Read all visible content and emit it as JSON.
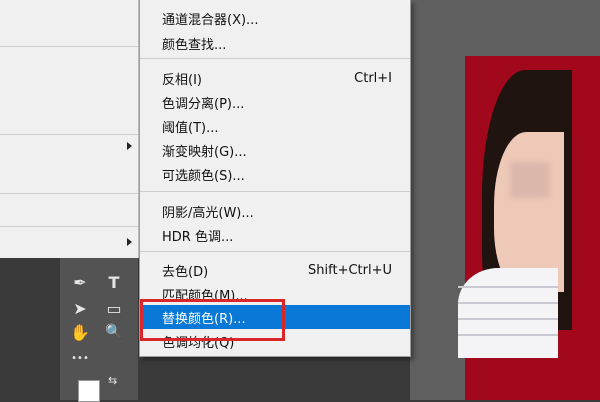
{
  "submenu": {
    "items": [
      {
        "label": "通道混合器(X)...",
        "shortcut": ""
      },
      {
        "label": "颜色查找...",
        "shortcut": ""
      },
      {
        "label": "反相(I)",
        "shortcut": "Ctrl+I"
      },
      {
        "label": "色调分离(P)...",
        "shortcut": ""
      },
      {
        "label": "阈值(T)...",
        "shortcut": ""
      },
      {
        "label": "渐变映射(G)...",
        "shortcut": ""
      },
      {
        "label": "可选颜色(S)...",
        "shortcut": ""
      },
      {
        "label": "阴影/高光(W)...",
        "shortcut": ""
      },
      {
        "label": "HDR 色调...",
        "shortcut": ""
      },
      {
        "label": "去色(D)",
        "shortcut": "Shift+Ctrl+U"
      },
      {
        "label": "匹配颜色(M)...",
        "shortcut": ""
      },
      {
        "label": "替换颜色(R)...",
        "shortcut": "",
        "highlighted": true
      },
      {
        "label": "色调均化(Q)",
        "shortcut": ""
      }
    ]
  },
  "toolbar": {
    "tools": [
      {
        "icon": "pen-tool-icon",
        "glyph": "✒"
      },
      {
        "icon": "type-tool-icon",
        "glyph": "T"
      },
      {
        "icon": "path-selection-icon",
        "glyph": "➤"
      },
      {
        "icon": "rectangle-tool-icon",
        "glyph": "▭"
      },
      {
        "icon": "hand-tool-icon",
        "glyph": "✋"
      },
      {
        "icon": "zoom-tool-icon",
        "glyph": "🔍"
      },
      {
        "icon": "more-tools-icon",
        "glyph": "•••"
      }
    ],
    "swap_glyph": "⇆"
  },
  "colors": {
    "highlight": "#0a78d7",
    "callout": "#d9262a",
    "photo_background": "#a1081c"
  }
}
